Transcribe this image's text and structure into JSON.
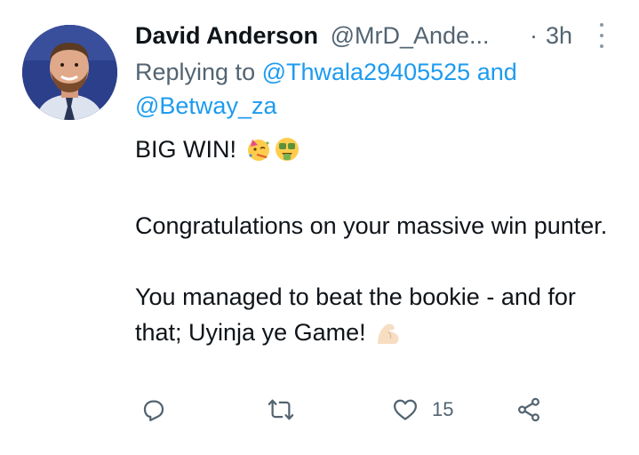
{
  "tweet": {
    "display_name": "David Anderson",
    "handle": "@MrD_Ande...",
    "separator": "·",
    "timestamp": "3h",
    "replying_prefix": "Replying to",
    "reply_mention_1": "@Thwala29405525",
    "reply_and": "and",
    "reply_mention_2": "@Betway_za",
    "line1_text": "BIG WIN!",
    "line1_emojis": [
      "partying-face-emoji",
      "money-mouth-face-emoji"
    ],
    "para2": "Congratulations on your massive win punter.",
    "para3": "You managed to beat the bookie - and for that; Uyinja ye Game!",
    "para3_emoji": "flexed-biceps-emoji"
  },
  "actions": {
    "reply_icon": "reply-icon",
    "retweet_icon": "retweet-icon",
    "like_icon": "heart-icon",
    "like_count": "15",
    "share_icon": "share-icon"
  },
  "colors": {
    "text": "#0f1419",
    "secondary": "#536471",
    "link": "#1d9bf0",
    "avatar_bg": "#2b3f8a"
  }
}
